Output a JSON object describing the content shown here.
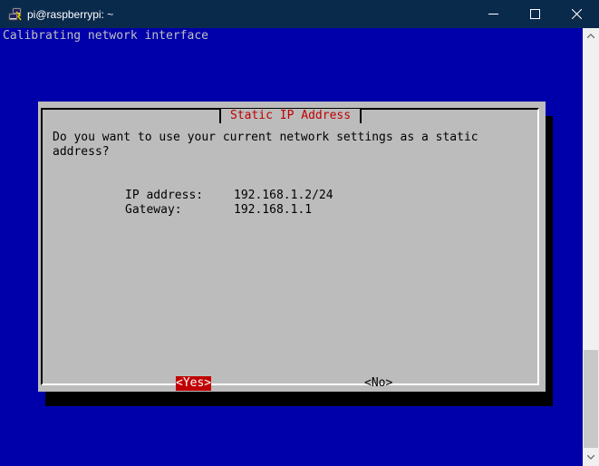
{
  "window": {
    "title": "pi@raspberrypi: ~"
  },
  "terminal": {
    "status_line": "Calibrating network interface"
  },
  "dialog": {
    "title": "Static IP Address",
    "message": "Do you want to use your current network settings as a static\naddress?",
    "fields": [
      {
        "label": "IP address:",
        "value": "192.168.1.2/24"
      },
      {
        "label": "Gateway:",
        "value": "192.168.1.1"
      }
    ],
    "buttons": {
      "yes": "<Yes>",
      "no": "<No>"
    }
  },
  "colors": {
    "terminal_background": "#0000aa",
    "dialog_background": "#bcbcbc",
    "title_text": "#c00000",
    "selected_button": "#c00000",
    "titlebar": "#0a2a4c"
  },
  "icons": {
    "app": "putty-icon",
    "minimize": "minimize-icon",
    "maximize": "maximize-icon",
    "close": "close-icon"
  }
}
